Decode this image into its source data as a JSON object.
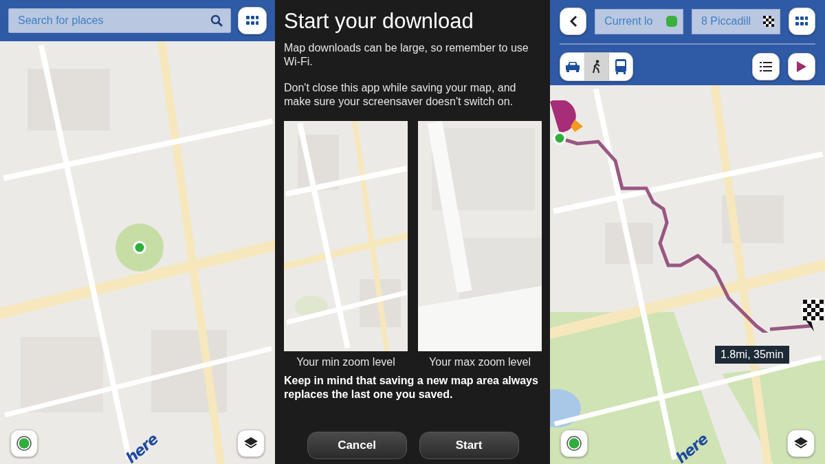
{
  "search_screen": {
    "search": {
      "placeholder": "Search for places"
    },
    "logo": "here"
  },
  "download_dialog": {
    "title": "Start your download",
    "paragraphs": [
      "Map downloads can be large, so remember to use Wi-Fi.",
      "Don't close this app while saving your map, and make sure your screensaver doesn't switch on."
    ],
    "previews": [
      {
        "caption": "Your min zoom level"
      },
      {
        "caption": "Your max zoom level"
      }
    ],
    "note": "Keep in mind that saving a new map area always replaces the last one you saved.",
    "buttons": [
      {
        "label": "Cancel"
      },
      {
        "label": "Start"
      }
    ]
  },
  "route_screen": {
    "from": {
      "value": "Current lo"
    },
    "to": {
      "value": "8 Piccadill"
    },
    "modes": [
      {
        "kind": "car",
        "selected": false
      },
      {
        "kind": "walk",
        "selected": true
      },
      {
        "kind": "bus",
        "selected": false
      }
    ],
    "summary": "1.8mi, 35min",
    "logo": "here"
  }
}
